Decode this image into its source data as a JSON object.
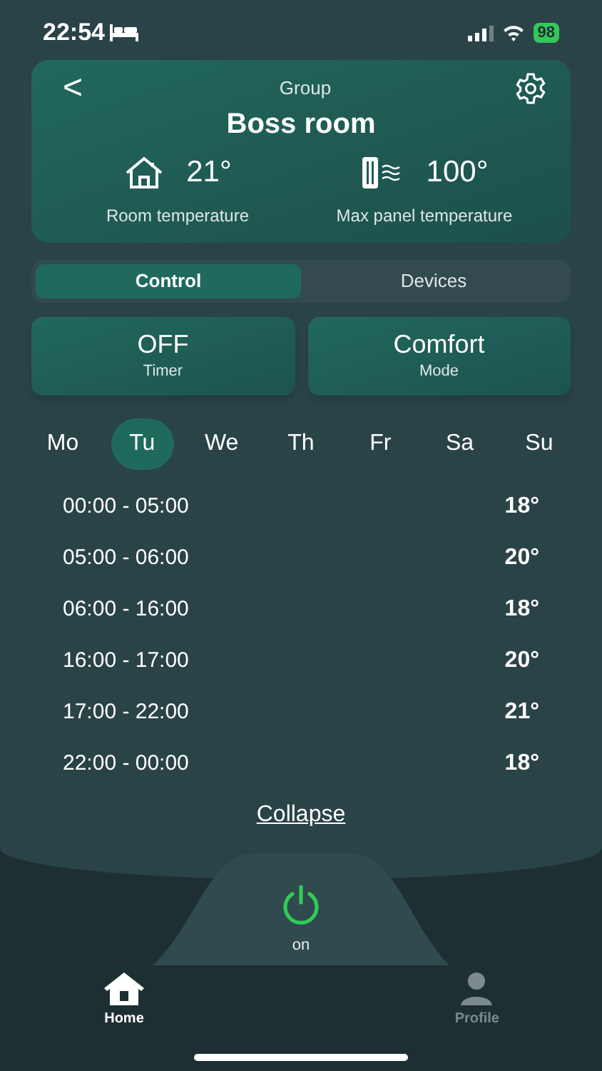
{
  "status_bar": {
    "time": "22:54",
    "battery": "98"
  },
  "header": {
    "back": "<",
    "subtitle": "Group",
    "title": "Boss room",
    "stats": [
      {
        "kind": "house",
        "value": "21°",
        "label": "Room temperature"
      },
      {
        "kind": "panel",
        "value": "100°",
        "label": "Max panel temperature"
      }
    ]
  },
  "tabs": [
    {
      "label": "Control",
      "selected": true
    },
    {
      "label": "Devices",
      "selected": false
    }
  ],
  "tiles": [
    {
      "value": "OFF",
      "label": "Timer"
    },
    {
      "value": "Comfort",
      "label": "Mode"
    }
  ],
  "days": [
    {
      "label": "Mo",
      "selected": false
    },
    {
      "label": "Tu",
      "selected": true
    },
    {
      "label": "We",
      "selected": false
    },
    {
      "label": "Th",
      "selected": false
    },
    {
      "label": "Fr",
      "selected": false
    },
    {
      "label": "Sa",
      "selected": false
    },
    {
      "label": "Su",
      "selected": false
    }
  ],
  "schedule": [
    {
      "time": "00:00 - 05:00",
      "temp": "18°"
    },
    {
      "time": "05:00 - 06:00",
      "temp": "20°"
    },
    {
      "time": "06:00 - 16:00",
      "temp": "18°"
    },
    {
      "time": "16:00 - 17:00",
      "temp": "20°"
    },
    {
      "time": "17:00 - 22:00",
      "temp": "21°"
    },
    {
      "time": "22:00 - 00:00",
      "temp": "18°"
    }
  ],
  "collapse": "Collapse",
  "power": {
    "label": "on",
    "on": true
  },
  "nav": [
    {
      "kind": "home",
      "label": "Home",
      "selected": true
    },
    {
      "kind": "profile",
      "label": "Profile",
      "selected": false
    }
  ]
}
